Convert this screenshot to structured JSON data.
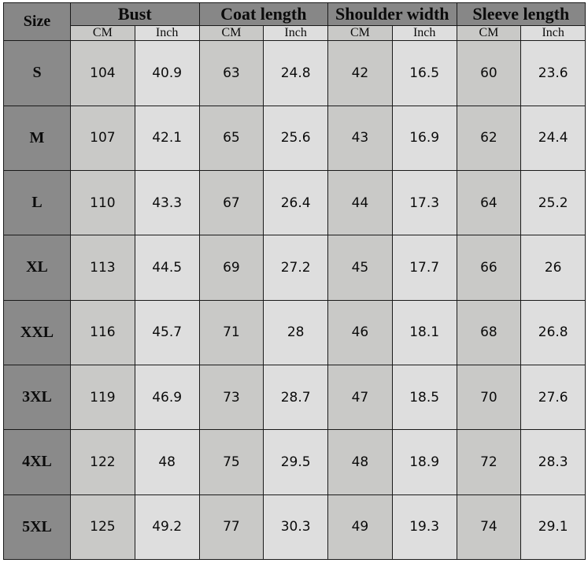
{
  "table": {
    "size_header": "Size",
    "groups": [
      {
        "label": "Bust"
      },
      {
        "label": "Coat length"
      },
      {
        "label": "Shoulder width"
      },
      {
        "label": "Sleeve length"
      }
    ],
    "units": [
      "CM",
      "Inch",
      "CM",
      "Inch",
      "CM",
      "Inch",
      "CM",
      "Inch"
    ],
    "rows": [
      {
        "size": "S",
        "values": [
          "104",
          "40.9",
          "63",
          "24.8",
          "42",
          "16.5",
          "60",
          "23.6"
        ]
      },
      {
        "size": "M",
        "values": [
          "107",
          "42.1",
          "65",
          "25.6",
          "43",
          "16.9",
          "62",
          "24.4"
        ]
      },
      {
        "size": "L",
        "values": [
          "110",
          "43.3",
          "67",
          "26.4",
          "44",
          "17.3",
          "64",
          "25.2"
        ]
      },
      {
        "size": "XL",
        "values": [
          "113",
          "44.5",
          "69",
          "27.2",
          "45",
          "17.7",
          "66",
          "26"
        ]
      },
      {
        "size": "XXL",
        "values": [
          "116",
          "45.7",
          "71",
          "28",
          "46",
          "18.1",
          "68",
          "26.8"
        ]
      },
      {
        "size": "3XL",
        "values": [
          "119",
          "46.9",
          "73",
          "28.7",
          "47",
          "18.5",
          "70",
          "27.6"
        ]
      },
      {
        "size": "4XL",
        "values": [
          "122",
          "48",
          "75",
          "29.5",
          "48",
          "18.9",
          "72",
          "28.3"
        ]
      },
      {
        "size": "5XL",
        "values": [
          "125",
          "49.2",
          "77",
          "30.3",
          "49",
          "19.3",
          "74",
          "29.1"
        ]
      }
    ]
  },
  "colors": {
    "header_gray": "#878787",
    "size_cell_gray": "#8a8a8a",
    "cm_gray": "#c9c9c7",
    "inch_gray": "#dedede",
    "border": "#1a1a1a",
    "text": "#0b0b0b"
  }
}
